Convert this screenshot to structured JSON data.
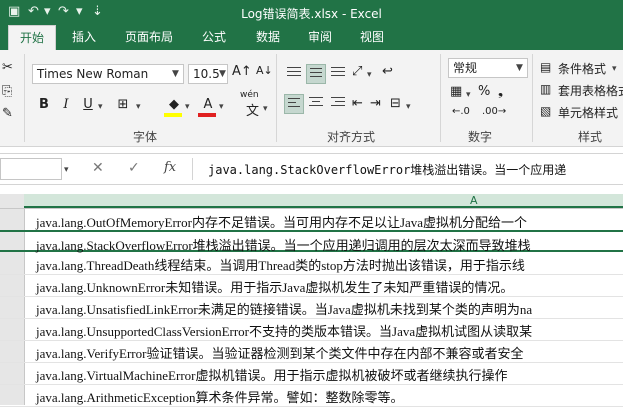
{
  "window": {
    "title": "Log错误简表.xlsx - Excel"
  },
  "tabs": [
    {
      "label": "开始"
    },
    {
      "label": "插入"
    },
    {
      "label": "页面布局"
    },
    {
      "label": "公式"
    },
    {
      "label": "数据"
    },
    {
      "label": "审阅"
    },
    {
      "label": "视图"
    }
  ],
  "ribbon": {
    "font_name": "Times New Roman",
    "font_size": "10.5",
    "number_format": "常规",
    "groups": {
      "font": "字体",
      "alignment": "对齐方式",
      "number": "数字",
      "styles": "样式"
    },
    "styles_items": [
      "条件格式",
      "套用表格格式",
      "单元格样式"
    ],
    "wen": "wén",
    "wen_char": "文",
    "percent": "%"
  },
  "formula_bar": {
    "fx": "fx",
    "content": "java.lang.StackOverflowError堆栈溢出错误。当一个应用递"
  },
  "grid": {
    "column": "A",
    "rows": [
      "java.lang.OutOfMemoryError内存不足错误。当可用内存不足以让Java虚拟机分配给一个",
      "java.lang.StackOverflowError堆栈溢出错误。当一个应用递归调用的层次太深而导致堆栈",
      "java.lang.ThreadDeath线程结束。当调用Thread类的stop方法时抛出该错误，用于指示线",
      "java.lang.UnknownError未知错误。用于指示Java虚拟机发生了未知严重错误的情况。",
      "java.lang.UnsatisfiedLinkError未满足的链接错误。当Java虚拟机未找到某个类的声明为na",
      "java.lang.UnsupportedClassVersionError不支持的类版本错误。当Java虚拟机试图从读取某",
      "java.lang.VerifyError验证错误。当验证器检测到某个类文件中存在内部不兼容或者安全",
      "java.lang.VirtualMachineError虚拟机错误。用于指示虚拟机被破坏或者继续执行操作",
      "java.lang.ArithmeticException算术条件异常。譬如：整数除零等。"
    ]
  }
}
